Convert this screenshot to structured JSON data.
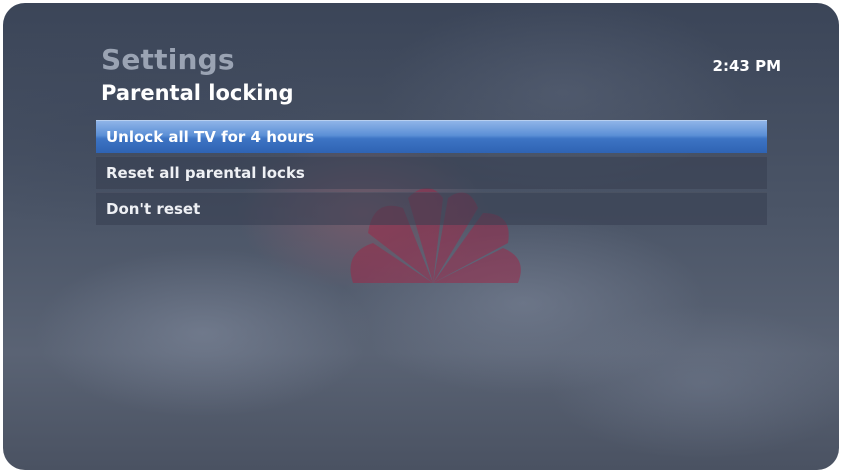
{
  "header": {
    "title": "Settings",
    "subtitle": "Parental locking",
    "time": "2:43 PM"
  },
  "menu": {
    "items": [
      {
        "label": "Unlock all TV for 4 hours",
        "selected": true
      },
      {
        "label": "Reset all parental locks",
        "selected": false
      },
      {
        "label": "Don't reset",
        "selected": false
      }
    ]
  },
  "colors": {
    "selection_top": "#8fb4e8",
    "selection_bottom": "#2f63b3",
    "title_gray": "#9aa3b3",
    "text_white": "#ffffff"
  },
  "icons": {
    "background_logo": "peacock-logo-icon"
  }
}
